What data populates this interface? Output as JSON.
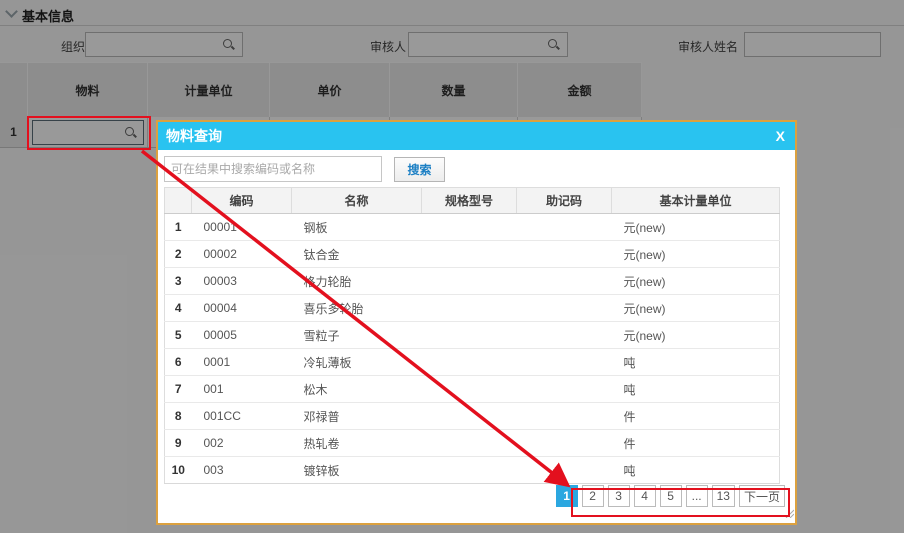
{
  "page": {
    "section_title": "基本信息",
    "form": {
      "org_label": "组织",
      "auditor_label": "审核人",
      "auditor_name_label": "审核人姓名"
    },
    "grid": {
      "columns": [
        "物料",
        "计量单位",
        "单价",
        "数量",
        "金额"
      ],
      "row1_seq": "1"
    }
  },
  "modal": {
    "title": "物料查询",
    "close_label": "X",
    "search": {
      "placeholder": "可在结果中搜索编码或名称",
      "button_label": "搜索"
    },
    "table": {
      "columns": [
        "编码",
        "名称",
        "规格型号",
        "助记码",
        "基本计量单位"
      ],
      "rows": [
        {
          "seq": "1",
          "code": "00001",
          "name": "钢板",
          "spec": "",
          "mnemonic": "",
          "unit": "元(new)"
        },
        {
          "seq": "2",
          "code": "00002",
          "name": "钛合金",
          "spec": "",
          "mnemonic": "",
          "unit": "元(new)"
        },
        {
          "seq": "3",
          "code": "00003",
          "name": "格力轮胎",
          "spec": "",
          "mnemonic": "",
          "unit": "元(new)"
        },
        {
          "seq": "4",
          "code": "00004",
          "name": "喜乐多轮胎",
          "spec": "",
          "mnemonic": "",
          "unit": "元(new)"
        },
        {
          "seq": "5",
          "code": "00005",
          "name": "雪粒子",
          "spec": "",
          "mnemonic": "",
          "unit": "元(new)"
        },
        {
          "seq": "6",
          "code": "0001",
          "name": "冷轧薄板",
          "spec": "",
          "mnemonic": "",
          "unit": "吨"
        },
        {
          "seq": "7",
          "code": "001",
          "name": "松木",
          "spec": "",
          "mnemonic": "",
          "unit": "吨"
        },
        {
          "seq": "8",
          "code": "001CC",
          "name": "邓禄普",
          "spec": "",
          "mnemonic": "",
          "unit": "件"
        },
        {
          "seq": "9",
          "code": "002",
          "name": "热轧卷",
          "spec": "",
          "mnemonic": "",
          "unit": "件"
        },
        {
          "seq": "10",
          "code": "003",
          "name": "镀锌板",
          "spec": "",
          "mnemonic": "",
          "unit": "吨"
        }
      ]
    },
    "pagination": {
      "pages": [
        "1",
        "2",
        "3",
        "4",
        "5",
        "...",
        "13"
      ],
      "active_page": "1",
      "next_label": "下一页"
    }
  },
  "colors": {
    "modal_header": "#29c3f0",
    "modal_border": "#dca13f",
    "annotation_red": "#e3101e",
    "pagination_active": "#2ba7e0",
    "search_button_text": "#1b7fc4",
    "dim_overlay": "rgba(0,0,0,0.40)"
  }
}
